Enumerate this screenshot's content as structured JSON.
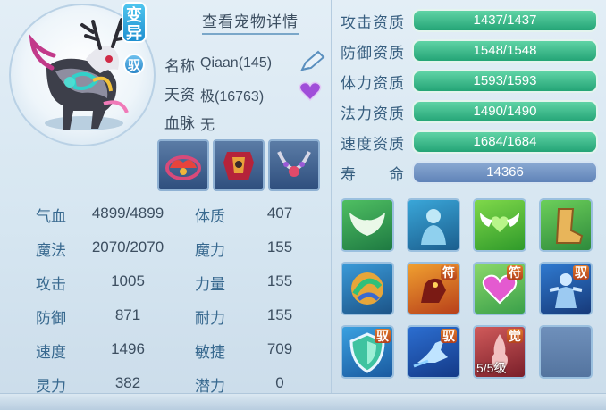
{
  "pet": {
    "mutation_tag": "变异",
    "tame_tag": "驭",
    "detail_link": "查看宠物详情",
    "name_label": "名称",
    "name_value": "Qiaan(145)",
    "talent_label": "天资",
    "talent_value": "极(16763)",
    "blood_label": "血脉",
    "blood_value": "无"
  },
  "equipment": [
    {
      "name": "wing-collar-icon"
    },
    {
      "name": "red-armor-icon"
    },
    {
      "name": "necklace-icon"
    }
  ],
  "stats": [
    {
      "label": "气血",
      "value": "4899/4899",
      "label2": "体质",
      "value2": "407"
    },
    {
      "label": "魔法",
      "value": "2070/2070",
      "label2": "魔力",
      "value2": "155"
    },
    {
      "label": "攻击",
      "value": "1005",
      "label2": "力量",
      "value2": "155"
    },
    {
      "label": "防御",
      "value": "871",
      "label2": "耐力",
      "value2": "155"
    },
    {
      "label": "速度",
      "value": "1496",
      "label2": "敏捷",
      "value2": "709"
    },
    {
      "label": "灵力",
      "value": "382",
      "label2": "潜力",
      "value2": "0"
    }
  ],
  "aptitudes": [
    {
      "label": "攻击资质",
      "value": "1437/1437",
      "fill": 1.0
    },
    {
      "label": "防御资质",
      "value": "1548/1548",
      "fill": 1.0
    },
    {
      "label": "体力资质",
      "value": "1593/1593",
      "fill": 1.0
    },
    {
      "label": "法力资质",
      "value": "1490/1490",
      "fill": 1.0
    },
    {
      "label": "速度资质",
      "value": "1684/1684",
      "fill": 1.0
    },
    {
      "label": "寿　　命",
      "value": "14366",
      "fill": 1.0
    }
  ],
  "skills": [
    {
      "name": "wings-skill-icon",
      "badge": "",
      "level": ""
    },
    {
      "name": "spirit-figure-skill-icon",
      "badge": "",
      "level": ""
    },
    {
      "name": "heart-wings-skill-icon",
      "badge": "",
      "level": ""
    },
    {
      "name": "boot-skill-icon",
      "badge": "",
      "level": ""
    },
    {
      "name": "swirl-skill-icon",
      "badge": "",
      "level": ""
    },
    {
      "name": "beast-skill-icon",
      "badge": "符",
      "level": ""
    },
    {
      "name": "heart-charm-skill-icon",
      "badge": "符",
      "level": ""
    },
    {
      "name": "fighter-skill-icon",
      "badge": "驭",
      "level": ""
    },
    {
      "name": "shield-skill-icon",
      "badge": "驭",
      "level": ""
    },
    {
      "name": "dash-skill-icon",
      "badge": "驭",
      "level": ""
    },
    {
      "name": "awaken-skill-icon",
      "badge": "觉",
      "level": "5/5级"
    },
    {
      "name": "empty-skill-slot",
      "badge": "",
      "level": ""
    }
  ]
}
